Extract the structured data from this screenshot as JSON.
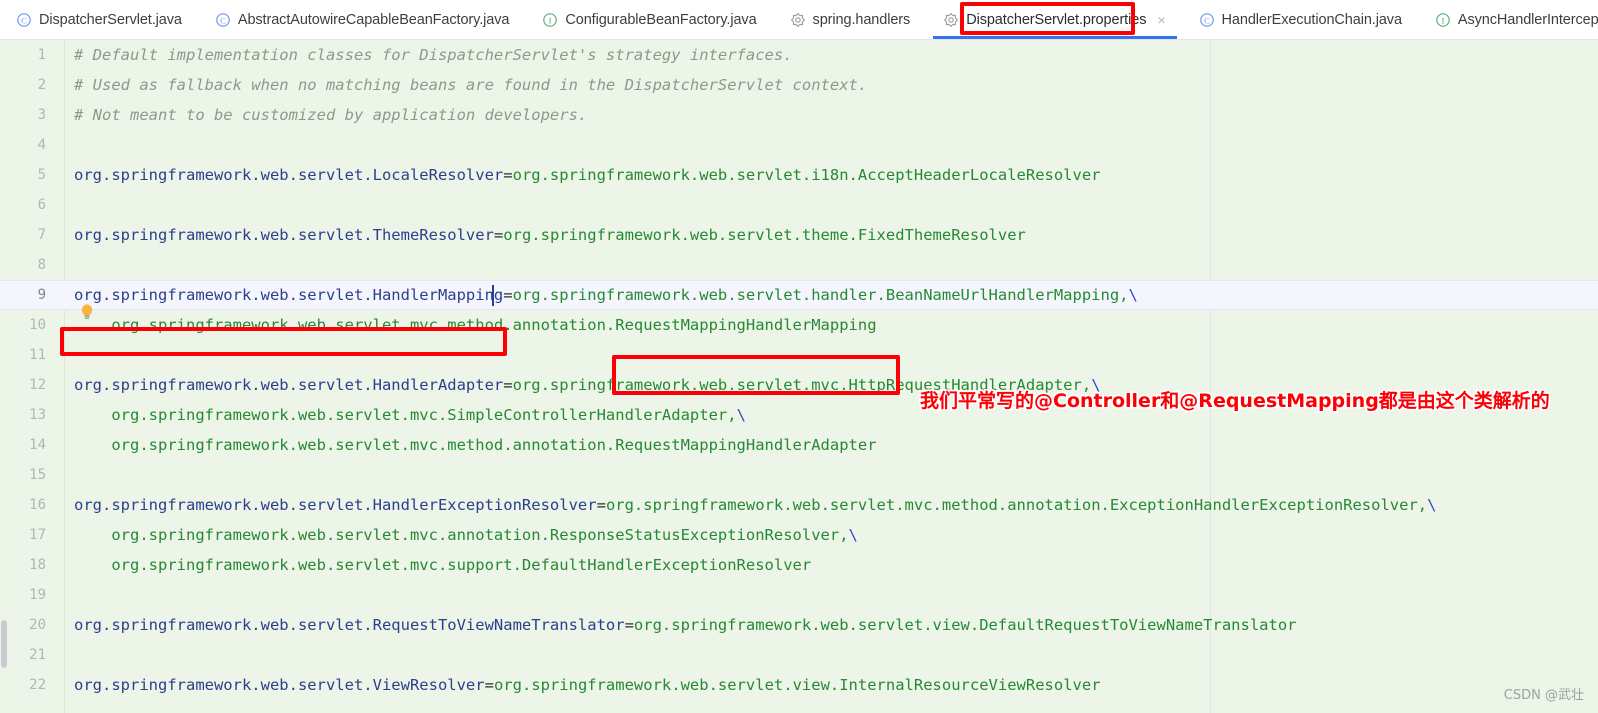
{
  "tabs": [
    {
      "label": "DispatcherServlet.java",
      "icon": "java-class-icon",
      "icon_kind": "class",
      "active": false,
      "closable": false
    },
    {
      "label": "AbstractAutowireCapableBeanFactory.java",
      "icon": "java-class-icon",
      "icon_kind": "class",
      "active": false,
      "closable": false
    },
    {
      "label": "ConfigurableBeanFactory.java",
      "icon": "java-interface-icon",
      "icon_kind": "interface",
      "active": false,
      "closable": false
    },
    {
      "label": "spring.handlers",
      "icon": "properties-file-icon",
      "icon_kind": "properties",
      "active": false,
      "closable": false
    },
    {
      "label": "DispatcherServlet.properties",
      "icon": "properties-file-icon",
      "icon_kind": "properties",
      "active": true,
      "closable": true,
      "close_label": "×"
    },
    {
      "label": "HandlerExecutionChain.java",
      "icon": "java-class-icon",
      "icon_kind": "class",
      "active": false,
      "closable": false
    },
    {
      "label": "AsyncHandlerIntercept",
      "icon": "java-interface-icon",
      "icon_kind": "interface",
      "active": false,
      "closable": false
    }
  ],
  "editor": {
    "lines": [
      {
        "n": "1",
        "indent": 0,
        "kind": "comment",
        "text": "# Default implementation classes for DispatcherServlet's strategy interfaces."
      },
      {
        "n": "2",
        "indent": 0,
        "kind": "comment",
        "text": "# Used as fallback when no matching beans are found in the DispatcherServlet context."
      },
      {
        "n": "3",
        "indent": 0,
        "kind": "comment",
        "text": "# Not meant to be customized by application developers."
      },
      {
        "n": "4",
        "indent": 0,
        "kind": "blank",
        "text": ""
      },
      {
        "n": "5",
        "indent": 0,
        "kind": "pair",
        "key": "org.springframework.web.servlet.LocaleResolver",
        "sep": "=",
        "value": "org.springframework.web.servlet.i18n.AcceptHeaderLocaleResolver",
        "cont": ""
      },
      {
        "n": "6",
        "indent": 0,
        "kind": "blank",
        "text": ""
      },
      {
        "n": "7",
        "indent": 0,
        "kind": "pair",
        "key": "org.springframework.web.servlet.ThemeResolver",
        "sep": "=",
        "value": "org.springframework.web.servlet.theme.FixedThemeResolver",
        "cont": ""
      },
      {
        "n": "8",
        "indent": 0,
        "kind": "bulb",
        "text": ""
      },
      {
        "n": "9",
        "indent": 0,
        "kind": "pair",
        "current": true,
        "key": "org.springframework.web.servlet.HandlerMapping",
        "sep": "=",
        "value": "org.springframework.web.servlet.handler.BeanNameUrlHandlerMapping,",
        "cont": "\\"
      },
      {
        "n": "10",
        "indent": 1,
        "kind": "value",
        "value": "org.springframework.web.servlet.mvc.method.annotation.RequestMappingHandlerMapping",
        "cont": ""
      },
      {
        "n": "11",
        "indent": 0,
        "kind": "blank",
        "text": ""
      },
      {
        "n": "12",
        "indent": 0,
        "kind": "pair",
        "key": "org.springframework.web.servlet.HandlerAdapter",
        "sep": "=",
        "value": "org.springframework.web.servlet.mvc.HttpRequestHandlerAdapter,",
        "cont": "\\"
      },
      {
        "n": "13",
        "indent": 1,
        "kind": "value",
        "value": "org.springframework.web.servlet.mvc.SimpleControllerHandlerAdapter,",
        "cont": "\\"
      },
      {
        "n": "14",
        "indent": 1,
        "kind": "value",
        "value": "org.springframework.web.servlet.mvc.method.annotation.RequestMappingHandlerAdapter",
        "cont": ""
      },
      {
        "n": "15",
        "indent": 0,
        "kind": "blank",
        "text": ""
      },
      {
        "n": "16",
        "indent": 0,
        "kind": "pair",
        "key": "org.springframework.web.servlet.HandlerExceptionResolver",
        "sep": "=",
        "value": "org.springframework.web.servlet.mvc.method.annotation.ExceptionHandlerExceptionResolver,",
        "cont": "\\"
      },
      {
        "n": "17",
        "indent": 1,
        "kind": "value",
        "value": "org.springframework.web.servlet.mvc.annotation.ResponseStatusExceptionResolver,",
        "cont": "\\"
      },
      {
        "n": "18",
        "indent": 1,
        "kind": "value",
        "value": "org.springframework.web.servlet.mvc.support.DefaultHandlerExceptionResolver",
        "cont": ""
      },
      {
        "n": "19",
        "indent": 0,
        "kind": "blank",
        "text": ""
      },
      {
        "n": "20",
        "indent": 0,
        "kind": "pair",
        "key": "org.springframework.web.servlet.RequestToViewNameTranslator",
        "sep": "=",
        "value": "org.springframework.web.servlet.view.DefaultRequestToViewNameTranslator",
        "cont": ""
      },
      {
        "n": "21",
        "indent": 0,
        "kind": "blank",
        "text": ""
      },
      {
        "n": "22",
        "indent": 0,
        "kind": "pair",
        "key": "org.springframework.web.servlet.ViewResolver",
        "sep": "=",
        "value": "org.springframework.web.servlet.view.InternalResourceViewResolver",
        "cont": ""
      }
    ]
  },
  "annotation": {
    "text": "我们平常写的@Controller和@RequestMapping都是由这个类解析的",
    "color": "#fb0106"
  },
  "highlights": {
    "color": "#fb0106",
    "boxes": [
      "active-tab",
      "line-9-key",
      "line-10-class-name"
    ]
  },
  "watermark": {
    "text": "CSDN @武壮"
  },
  "colors": {
    "editor_background": "#edf4e8",
    "current_line_background": "#f5f6fd",
    "key_token": "#2b3f8c",
    "value_token": "#258a33",
    "comment_token": "#8c9a8c",
    "accent": "#3574f0"
  }
}
